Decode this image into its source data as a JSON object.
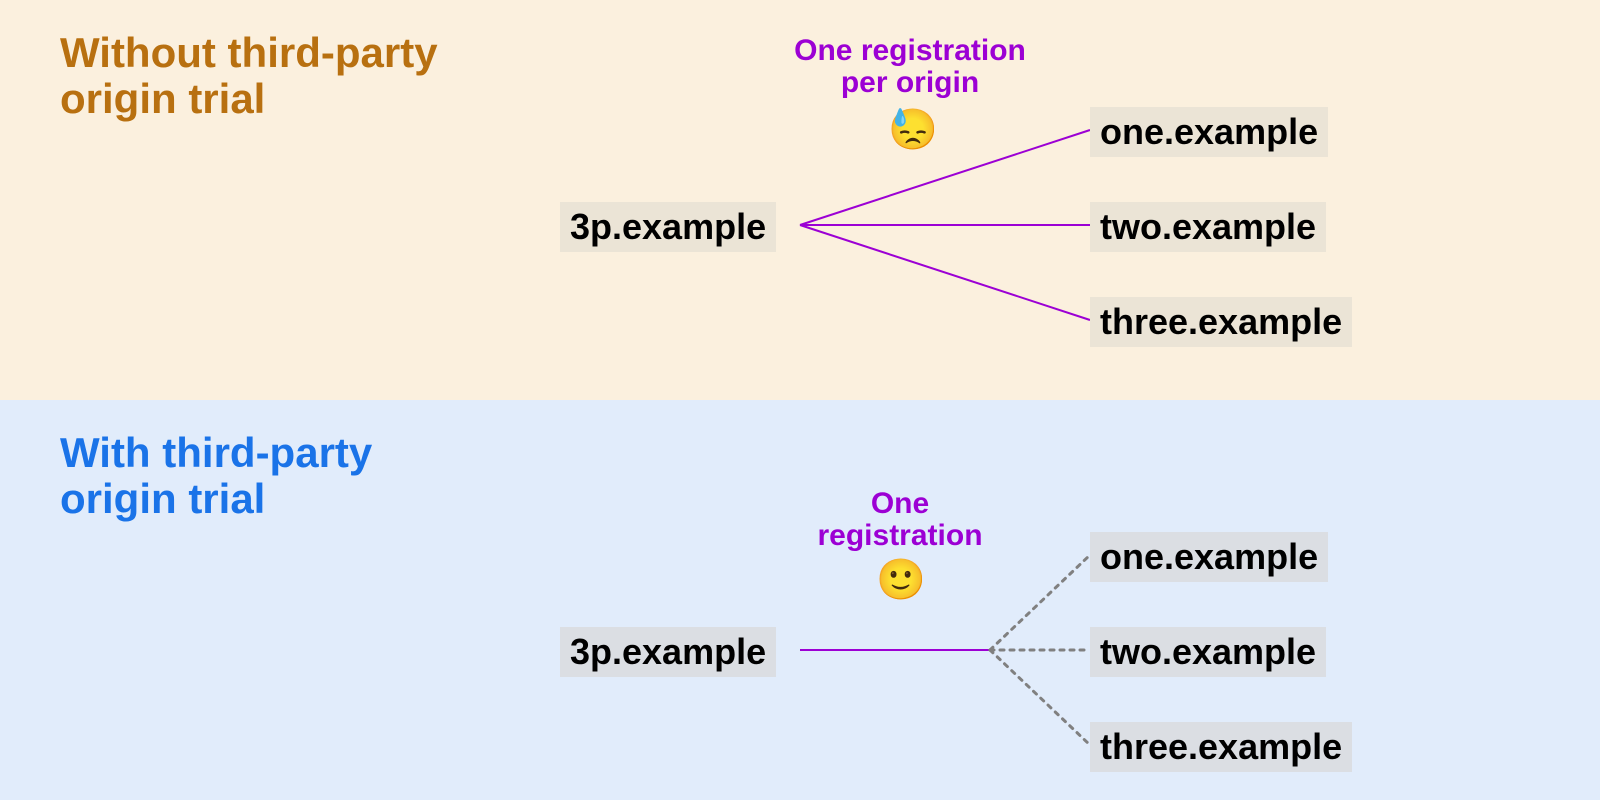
{
  "top": {
    "title": "Without third-party\norigin trial",
    "title_color": "#b87010",
    "bg": "#fbf0de",
    "source": "3p.example",
    "targets": [
      "one.example",
      "two.example",
      "three.example"
    ],
    "caption": "One registration\nper origin",
    "emoji": "😓",
    "line_color": "#9c00d4",
    "line_style": "solid_all"
  },
  "bottom": {
    "title": "With third-party\norigin trial",
    "title_color": "#1a73e8",
    "bg": "#e1ecfb",
    "source": "3p.example",
    "targets": [
      "one.example",
      "two.example",
      "three.example"
    ],
    "caption": "One\nregistration",
    "emoji": "🙂",
    "line_color_trunk": "#9c00d4",
    "line_color_branches": "#808080",
    "line_style": "trunk_then_dotted"
  }
}
